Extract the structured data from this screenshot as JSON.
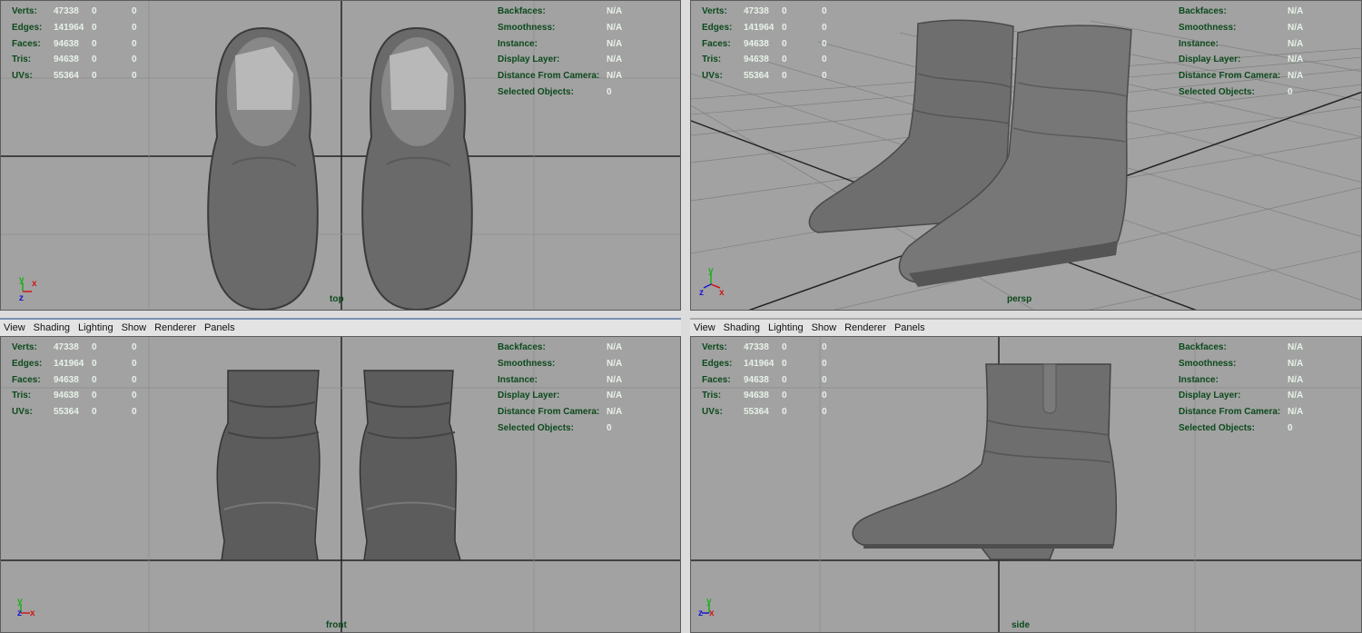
{
  "menu": [
    "View",
    "Shading",
    "Lighting",
    "Show",
    "Renderer",
    "Panels"
  ],
  "hud_left": {
    "rows": [
      {
        "label": "Verts:",
        "v1": "47338",
        "v2": "0",
        "v3": "0"
      },
      {
        "label": "Edges:",
        "v1": "141964",
        "v2": "0",
        "v3": "0"
      },
      {
        "label": "Faces:",
        "v1": "94638",
        "v2": "0",
        "v3": "0"
      },
      {
        "label": "Tris:",
        "v1": "94638",
        "v2": "0",
        "v3": "0"
      },
      {
        "label": "UVs:",
        "v1": "55364",
        "v2": "0",
        "v3": "0"
      }
    ]
  },
  "hud_right": {
    "rows": [
      {
        "label": "Backfaces:",
        "value": "N/A"
      },
      {
        "label": "Smoothness:",
        "value": "N/A"
      },
      {
        "label": "Instance:",
        "value": "N/A"
      },
      {
        "label": "Display Layer:",
        "value": "N/A"
      },
      {
        "label": "Distance From Camera:",
        "value": "N/A"
      },
      {
        "label": "Selected Objects:",
        "value": "0"
      }
    ]
  },
  "viewports": {
    "top": {
      "camera": "top"
    },
    "persp": {
      "camera": "persp"
    },
    "front": {
      "camera": "front"
    },
    "side": {
      "camera": "side"
    }
  },
  "axis_letters": {
    "x": "x",
    "y": "y",
    "z": "z"
  },
  "colors": {
    "viewport_bg": "#a2a2a2",
    "hud_label": "#0b4a1c",
    "hud_value": "#e8f2e8",
    "boot": "#6e6e6e",
    "axis_x": "#d01818",
    "axis_y": "#18b018",
    "axis_z": "#1818d0"
  },
  "icons": [
    "axis-gizmo-icon"
  ]
}
